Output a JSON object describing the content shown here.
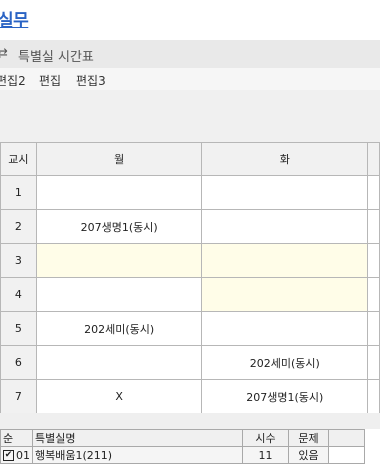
{
  "app": {
    "title": "실무"
  },
  "panel": {
    "icon": "swap-icon",
    "title": "특별실 시간표"
  },
  "menu": [
    "편집2",
    "편집",
    "편집3"
  ],
  "timetable": {
    "headers": [
      "교시",
      "월",
      "화"
    ],
    "rows": [
      {
        "period": "1",
        "cells": [
          "",
          ""
        ]
      },
      {
        "period": "2",
        "cells": [
          "207생명1(동시)",
          ""
        ]
      },
      {
        "period": "3",
        "cells": [
          "",
          ""
        ]
      },
      {
        "period": "4",
        "cells": [
          "",
          ""
        ]
      },
      {
        "period": "5",
        "cells": [
          "202세미(동시)",
          ""
        ]
      },
      {
        "period": "6",
        "cells": [
          "",
          "202세미(동시)"
        ]
      },
      {
        "period": "7",
        "cells": [
          "X",
          "207생명1(동시)"
        ]
      }
    ]
  },
  "list": {
    "headers": [
      "순",
      "특별실명",
      "시수",
      "문제"
    ],
    "rows": [
      {
        "checked": true,
        "check_mark": "✔",
        "order": "01",
        "name": "행복배움1(211)",
        "hours": "11",
        "issue": "있음"
      }
    ]
  }
}
